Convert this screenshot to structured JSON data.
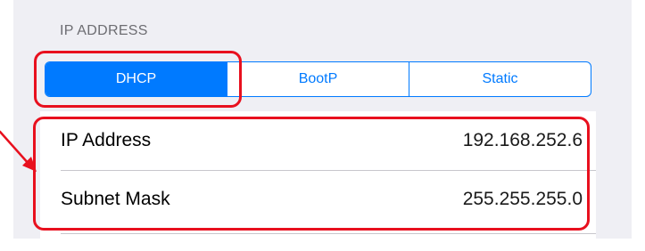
{
  "section": {
    "header": "IP ADDRESS"
  },
  "mode_selector": {
    "options": [
      "DHCP",
      "BootP",
      "Static"
    ],
    "selected": "DHCP"
  },
  "fields": [
    {
      "label": "IP Address",
      "value": "192.168.252.6"
    },
    {
      "label": "Subnet Mask",
      "value": "255.255.255.0"
    }
  ],
  "colors": {
    "accent": "#007aff",
    "annotation": "#e8101e",
    "grouped_background": "#efeff4"
  },
  "icons": {
    "annotation_arrow": "arrow-icon"
  }
}
